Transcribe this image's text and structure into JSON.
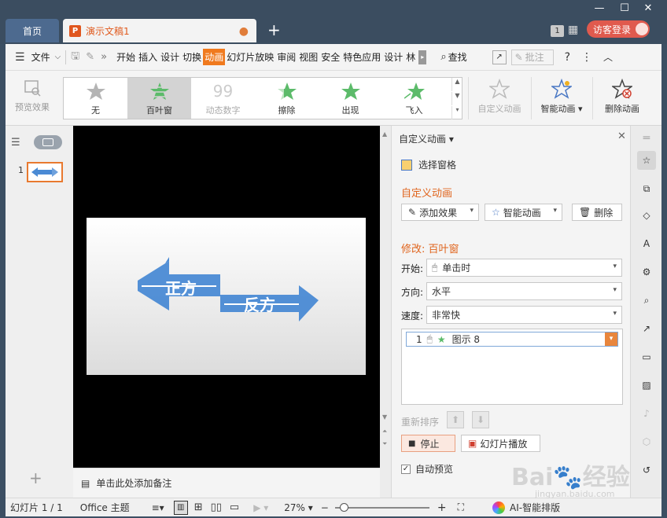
{
  "tabs": {
    "home": "首页",
    "doc": "演示文稿1",
    "add": "+"
  },
  "window": {
    "badge": "1",
    "login": "访客登录"
  },
  "menu": {
    "file": "文件",
    "items": [
      "开始",
      "插入",
      "设计",
      "切换",
      "动画",
      "幻灯片放映",
      "审阅",
      "视图",
      "安全",
      "特色应用",
      "设计",
      "林"
    ],
    "active_index": 4,
    "search": "查找",
    "annotate": "批注"
  },
  "ribbon": {
    "preview": "预览效果",
    "gallery": [
      "无",
      "百叶窗",
      "动态数字",
      "擦除",
      "出现",
      "飞入"
    ],
    "selected": 1,
    "custom": "自定义动画",
    "smart": "智能动画",
    "delete": "删除动画"
  },
  "slide": {
    "number": "1",
    "word_left": "正方",
    "word_right": "反方"
  },
  "notes": {
    "placeholder": "单击此处添加备注"
  },
  "taskpane": {
    "title": "自定义动画",
    "select_pane": "选择窗格",
    "section": "自定义动画",
    "add_effect": "添加效果",
    "smart_anim": "智能动画",
    "delete": "删除",
    "modify": "修改: 百叶窗",
    "start_label": "开始:",
    "start_value": "单击时",
    "direction_label": "方向:",
    "direction_value": "水平",
    "speed_label": "速度:",
    "speed_value": "非常快",
    "anim_item_index": "1",
    "anim_item_name": "图示 8",
    "reorder": "重新排序",
    "stop": "停止",
    "slideshow": "幻灯片播放",
    "auto_preview": "自动预览"
  },
  "status": {
    "slide": "幻灯片 1 / 1",
    "theme": "Office 主题",
    "zoom": "27%",
    "ai": "AI-智能排版"
  },
  "colors": {
    "accent": "#f07a1e",
    "titlebar": "#3b4d60",
    "arrow": "#4a8ad4"
  }
}
